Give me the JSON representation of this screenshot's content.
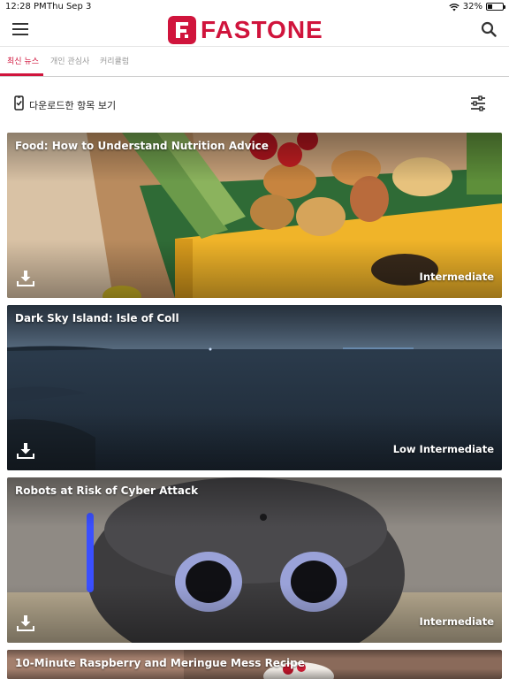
{
  "status_bar": {
    "time": "12:28 PM",
    "date": "Thu Sep 3",
    "battery_text": "32%",
    "battery_level": 0.32
  },
  "header": {
    "logo_letter": "F.",
    "logo_text": "FASTONE",
    "brand_color": "#d0143c"
  },
  "tabs": [
    {
      "label": "최신 뉴스",
      "active": true
    },
    {
      "label": "개인 관심사",
      "active": false
    },
    {
      "label": "커리큘럼",
      "active": false
    }
  ],
  "downloaded": {
    "label": "다운로드한 항목 보기"
  },
  "cards": [
    {
      "title": "Food: How to Understand Nutrition Advice",
      "level": "Intermediate",
      "icon": "download-icon"
    },
    {
      "title": "Dark Sky Island: Isle of Coll",
      "level": "Low Intermediate",
      "icon": "download-icon"
    },
    {
      "title": "Robots at Risk of Cyber Attack",
      "level": "Intermediate",
      "icon": "download-icon"
    },
    {
      "title": "10-Minute Raspberry and Meringue Mess Recipe",
      "level": "",
      "icon": "download-icon"
    }
  ]
}
